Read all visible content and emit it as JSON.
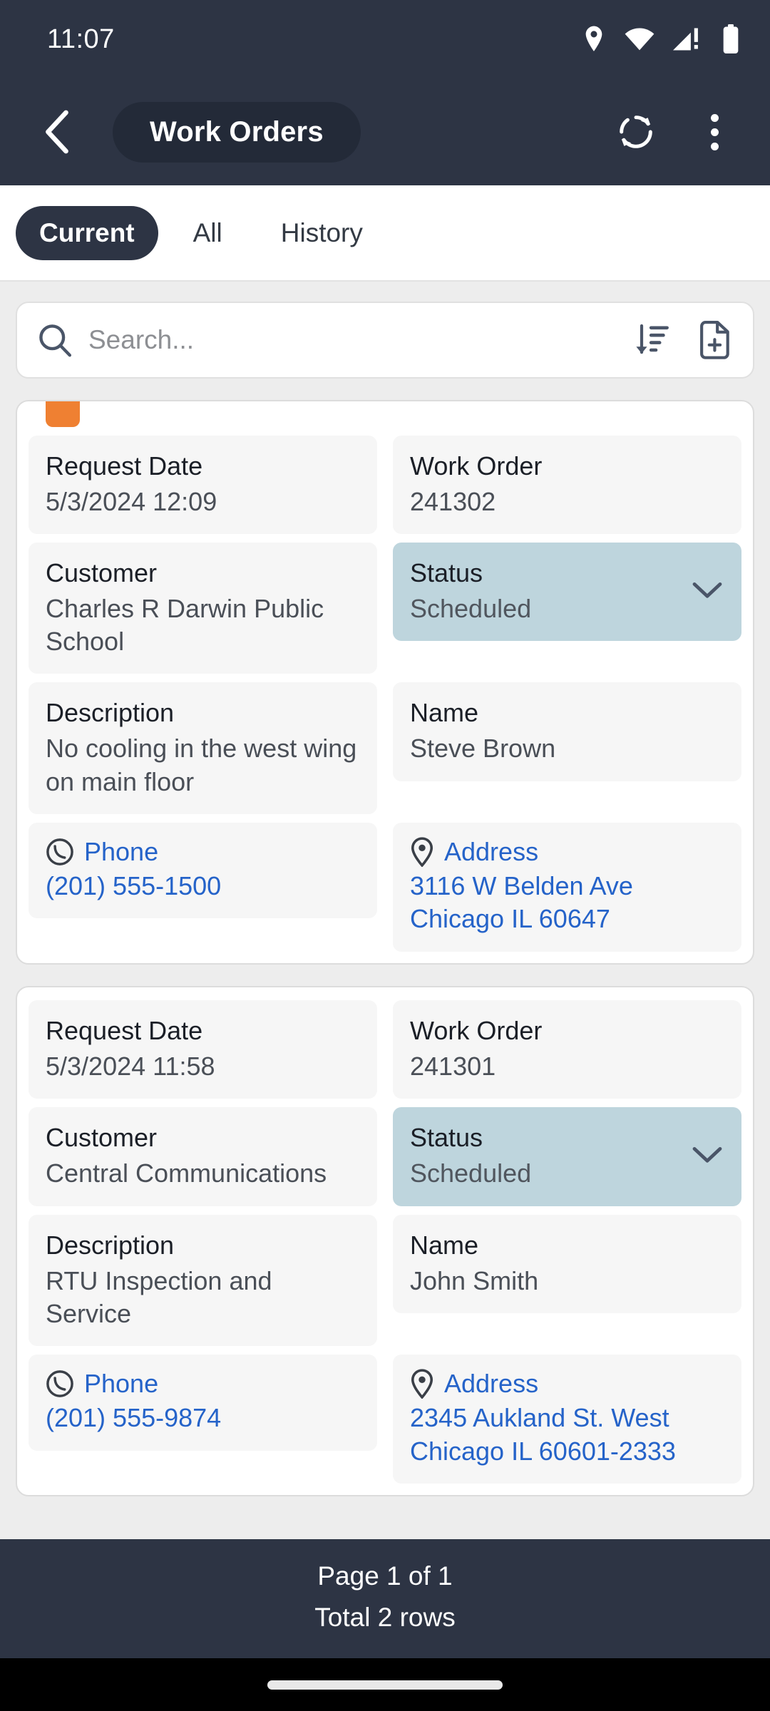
{
  "status_bar": {
    "time": "11:07",
    "icons": [
      "location-icon",
      "wifi-icon",
      "cellular-warning-icon",
      "battery-icon"
    ]
  },
  "app_bar": {
    "back_icon": "chevron-left-icon",
    "title": "Work Orders",
    "refresh_icon": "refresh-icon",
    "overflow_icon": "more-vertical-icon"
  },
  "tabs": [
    {
      "label": "Current",
      "active": true
    },
    {
      "label": "All",
      "active": false
    },
    {
      "label": "History",
      "active": false
    }
  ],
  "search": {
    "placeholder": "Search...",
    "value": "",
    "search_icon": "search-icon",
    "sort_icon": "sort-descending-icon",
    "new_icon": "new-document-icon"
  },
  "labels": {
    "request_date": "Request Date",
    "work_order": "Work Order",
    "customer": "Customer",
    "status": "Status",
    "description": "Description",
    "name": "Name",
    "phone": "Phone",
    "address": "Address"
  },
  "work_orders": [
    {
      "flagged": true,
      "flag_color": "#ef8032",
      "request_date": "5/3/2024 12:09",
      "work_order": "241302",
      "customer": "Charles R Darwin Public School",
      "status": "Scheduled",
      "description": "No cooling in the west wing on main floor",
      "name": "Steve Brown",
      "phone": "(201) 555-1500",
      "address_line1": "3116 W Belden Ave",
      "address_line2": "Chicago IL 60647"
    },
    {
      "flagged": false,
      "flag_color": "",
      "request_date": "5/3/2024 11:58",
      "work_order": "241301",
      "customer": "Central Communications",
      "status": "Scheduled",
      "description": "RTU Inspection and Service",
      "name": "John Smith",
      "phone": "(201) 555-9874",
      "address_line1": "2345 Aukland St. West",
      "address_line2": "Chicago IL 60601-2333"
    }
  ],
  "footer": {
    "page": "Page 1 of 1",
    "total": "Total 2 rows"
  },
  "colors": {
    "header_bg": "#2d3444",
    "title_pill_bg": "#232a38",
    "status_field_bg": "#bed5dd",
    "link_blue": "#2563c9",
    "flag_orange": "#ef8032",
    "page_bg": "#ededed"
  }
}
